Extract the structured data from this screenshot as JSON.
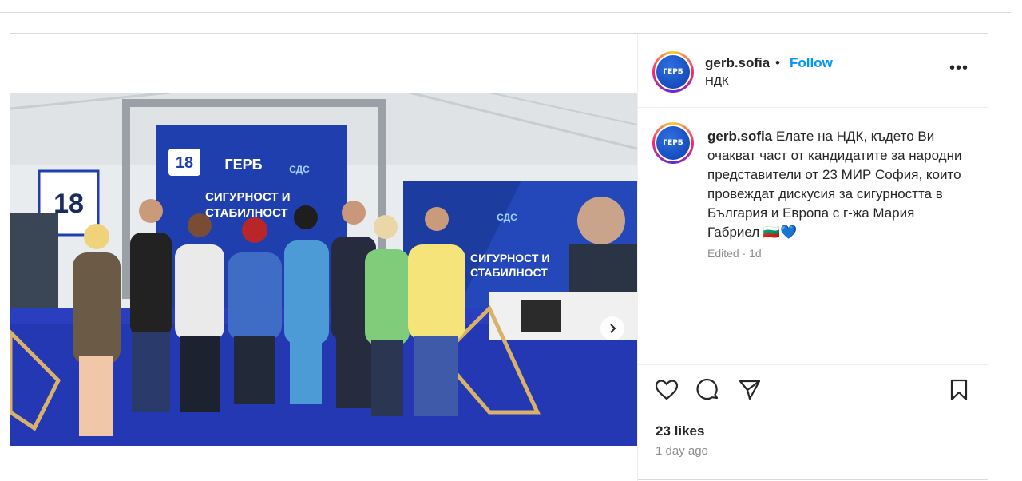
{
  "post": {
    "username": "gerb.sofia",
    "separator": "•",
    "follow_label": "Follow",
    "location": "НДК",
    "more_label": "•••",
    "avatar_text": "ГЕРБ",
    "caption_username": "gerb.sofia",
    "caption_text": " Елате на НДК, където Ви очакват част от кандидатите за народни представители от 23 МИР София, които провеждат дискусия за сигурността в България и Европа с г-жа Мария Габриел 🇧🇬💙",
    "caption_meta": "Edited · 1d",
    "likes": "23 likes",
    "time_ago": "1 day ago"
  },
  "photo": {
    "banner_number": "18",
    "banner_party": "ГЕРБ",
    "banner_ally": "СДС",
    "banner_slogan_line1": "СИГУРНОСТ И",
    "banner_slogan_line2": "СТАБИЛНОСТ",
    "side_banner_number": "18",
    "right_banner_slogan_line1": "СИГУРНОСТ И",
    "right_banner_slogan_line2": "СТАБИЛНОСТ",
    "right_banner_ally": "СДС",
    "carousel_count": 2,
    "carousel_active": 1
  },
  "icons": {
    "like": "heart-icon",
    "comment": "comment-icon",
    "share": "share-icon",
    "save": "bookmark-icon",
    "next": "chevron-right-icon"
  },
  "colors": {
    "follow": "#0095f6",
    "brand_blue": "#1f3fae"
  }
}
